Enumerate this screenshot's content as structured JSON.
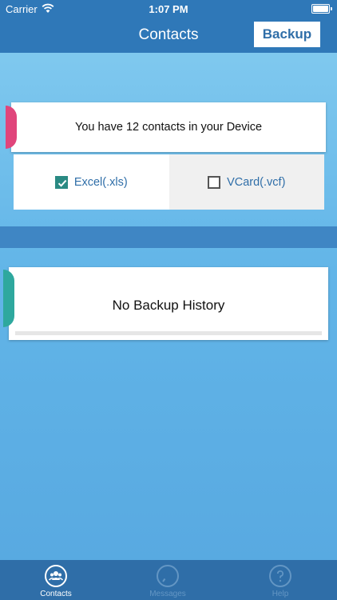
{
  "status": {
    "carrier": "Carrier",
    "time": "1:07 PM"
  },
  "nav": {
    "title": "Contacts",
    "backup_label": "Backup"
  },
  "contacts_card": {
    "message": "You have 12 contacts in your Device",
    "accent_color": "#e0457b"
  },
  "formats": [
    {
      "label": "Excel(.xls)",
      "checked": true
    },
    {
      "label": "VCard(.vcf)",
      "checked": false
    }
  ],
  "history_card": {
    "message": "No Backup History",
    "accent_color": "#2ea89e"
  },
  "tabs": [
    {
      "label": "Contacts",
      "icon": "contacts-icon",
      "active": true
    },
    {
      "label": "Messages",
      "icon": "messages-icon",
      "active": false
    },
    {
      "label": "Help",
      "icon": "help-icon",
      "active": false
    }
  ],
  "colors": {
    "primary": "#2f78b8",
    "check": "#2a8a83"
  }
}
